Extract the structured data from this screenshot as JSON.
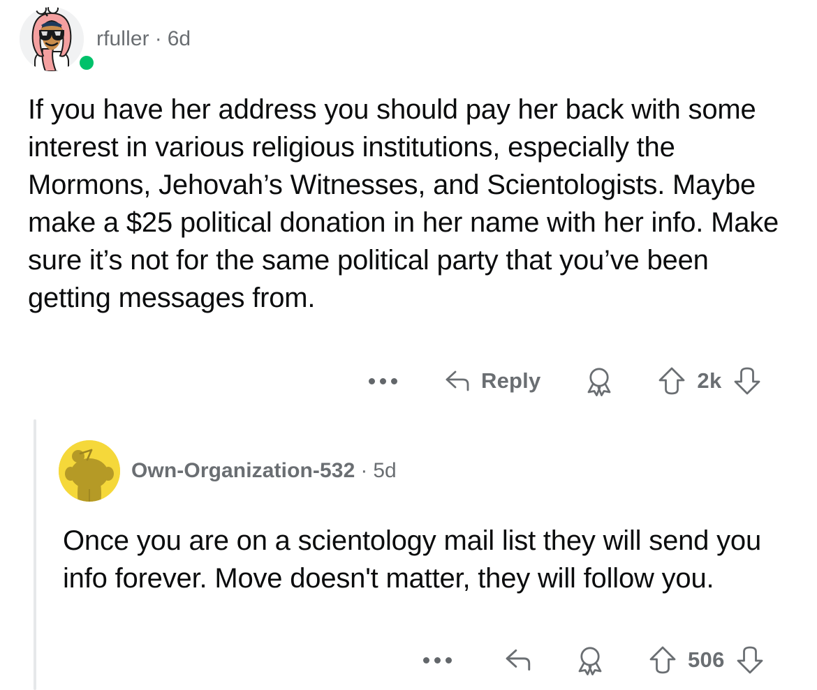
{
  "theme": {
    "background": "#ffffff",
    "text_color": "#0b0c0d",
    "meta_color": "#6a6e72",
    "thread_line_color": "#e6e8ea",
    "online_dot_color": "#00c16a",
    "avatar_bg_parent": "#f1f2f3",
    "avatar_bg_reply": "#f5d83a",
    "avatar_fg_reply": "#b59a26"
  },
  "comments": [
    {
      "id": "parent-comment",
      "author": "rfuller",
      "separator": "·",
      "timestamp": "6d",
      "online": true,
      "avatar_icon": "snoo-avatar-hijab-sunglasses",
      "body": "If you have her address you should pay her back with some interest in various religious institutions, especially the Mormons, Jehovah’s Witnesses, and Scientologists. Maybe make a $25 political donation in her name with her info. Make sure it’s not for the same political party that you’ve been getting messages from.",
      "actions": {
        "overflow_label": "…",
        "overflow_icon": "more-horizontal-icon",
        "reply_label": "Reply",
        "reply_icon": "reply-arrow-icon",
        "award_icon": "award-ribbon-icon",
        "upvote_icon": "upvote-arrow-icon",
        "downvote_icon": "downvote-arrow-icon",
        "vote_count": "2k"
      }
    },
    {
      "id": "child-reply",
      "author": "Own-Organization-532",
      "separator": "·",
      "timestamp": "5d",
      "online": false,
      "avatar_icon": "snoo-avatar-yellow",
      "body": "Once you are on a scientology mail list they will send you info forever.  Move doesn't matter, they will follow you.",
      "actions": {
        "overflow_label": "…",
        "overflow_icon": "more-horizontal-icon",
        "reply_label": "",
        "reply_icon": "reply-arrow-icon",
        "award_icon": "award-ribbon-icon",
        "upvote_icon": "upvote-arrow-icon",
        "downvote_icon": "downvote-arrow-icon",
        "vote_count": "506"
      }
    }
  ]
}
